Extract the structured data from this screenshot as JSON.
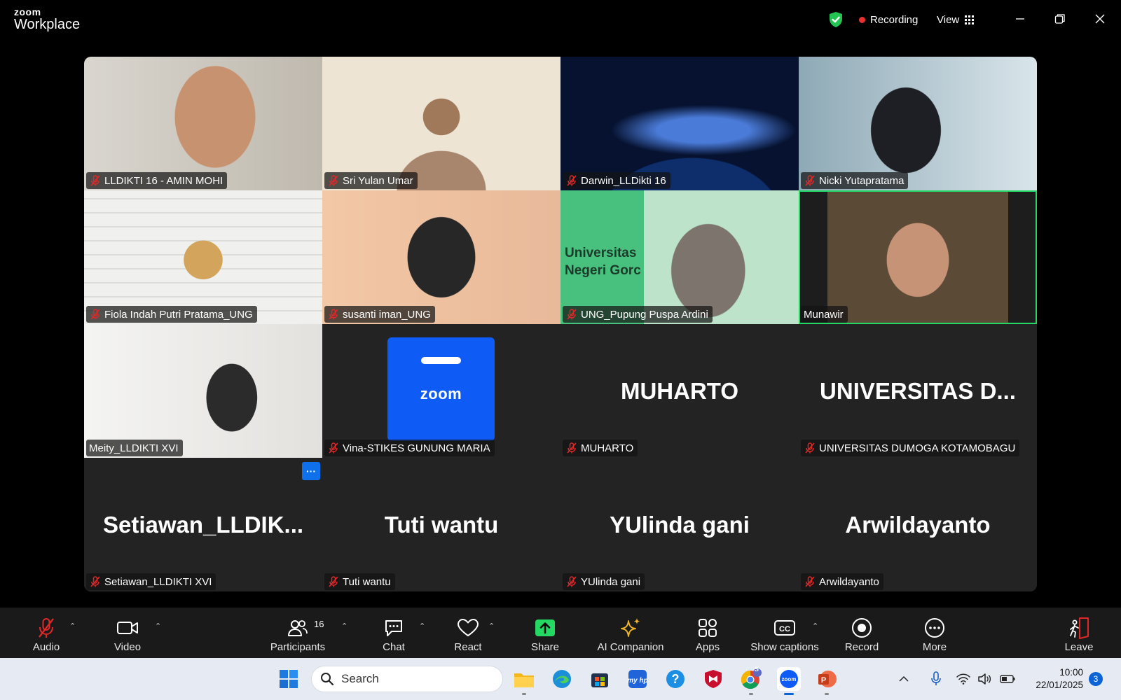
{
  "window": {
    "brand_small": "zoom",
    "brand_big": "Workplace",
    "recording_label": "Recording",
    "view_label": "View"
  },
  "participants": [
    {
      "name": "LLDIKTI 16 - AMIN MOHI",
      "muted": true,
      "video": true
    },
    {
      "name": "Sri Yulan Umar",
      "muted": true,
      "video": true
    },
    {
      "name": "Darwin_LLDikti 16",
      "muted": true,
      "video": true
    },
    {
      "name": "Nicki Yutapratama",
      "muted": true,
      "video": true
    },
    {
      "name": "Fiola Indah Putri Pratama_UNG",
      "muted": true,
      "video": true
    },
    {
      "name": "susanti iman_UNG",
      "muted": true,
      "video": true
    },
    {
      "name": "UNG_Pupung Puspa Ardini",
      "muted": true,
      "video": true,
      "background_text": [
        "Universitas",
        "Negeri Gorc"
      ]
    },
    {
      "name": "Munawir",
      "muted": false,
      "video": true,
      "active_speaker": true
    },
    {
      "name": "Meity_LLDIKTI XVI",
      "muted": false,
      "video": true
    },
    {
      "name": "Vina-STIKES GUNUNG MARIA",
      "muted": true,
      "video": false,
      "logo_text": "zoom"
    },
    {
      "name": "MUHARTO",
      "display": "MUHARTO",
      "muted": true,
      "video": false
    },
    {
      "name": "UNIVERSITAS DUMOGA KOTAMOBAGU",
      "display": "UNIVERSITAS  D...",
      "muted": true,
      "video": false
    },
    {
      "name": "Setiawan_LLDIKTI XVI",
      "display": "Setiawan_LLDIK...",
      "muted": true,
      "video": false,
      "more_button": "···"
    },
    {
      "name": "Tuti wantu",
      "display": "Tuti wantu",
      "muted": true,
      "video": false
    },
    {
      "name": "YUlinda gani",
      "display": "YUlinda gani",
      "muted": true,
      "video": false
    },
    {
      "name": "Arwildayanto",
      "display": "Arwildayanto",
      "muted": true,
      "video": false
    }
  ],
  "toolbar": {
    "audio": "Audio",
    "video": "Video",
    "participants": "Participants",
    "participants_count": "16",
    "chat": "Chat",
    "react": "React",
    "share": "Share",
    "ai_companion": "AI Companion",
    "apps": "Apps",
    "show_captions": "Show captions",
    "record": "Record",
    "more": "More",
    "leave": "Leave"
  },
  "taskbar": {
    "search_placeholder": "Search",
    "time": "10:00",
    "date": "22/01/2025",
    "notifications": "3",
    "chrome_badge": "S"
  },
  "colors": {
    "active_speaker_border": "#23d963",
    "recording_dot": "#e8312f",
    "share_green": "#23d963",
    "zoom_blue": "#0e5cf5",
    "muted_red": "#e02828"
  }
}
